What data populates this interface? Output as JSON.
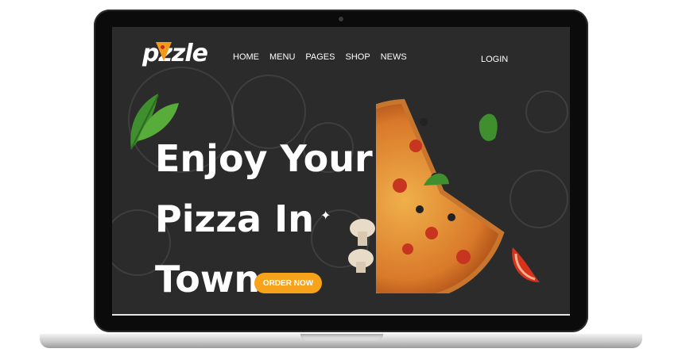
{
  "brand": {
    "logo_text": "pzzle"
  },
  "nav": {
    "items": [
      {
        "label": "HOME"
      },
      {
        "label": "MENU"
      },
      {
        "label": "PAGES"
      },
      {
        "label": "SHOP"
      },
      {
        "label": "NEWS"
      }
    ],
    "login_label": "LOGIN"
  },
  "hero": {
    "headline_line1": "Enjoy Your",
    "headline_line2": "Pizza In",
    "headline_line3": "Town",
    "cta_label": "ORDER NOW"
  },
  "colors": {
    "screen_bg": "#2b2b2b",
    "accent": "#f6a21a",
    "text": "#ffffff"
  },
  "icons": [
    "pizza-slice-icon",
    "basil-leaf-icon",
    "mushroom-icon",
    "tomato-icon"
  ]
}
